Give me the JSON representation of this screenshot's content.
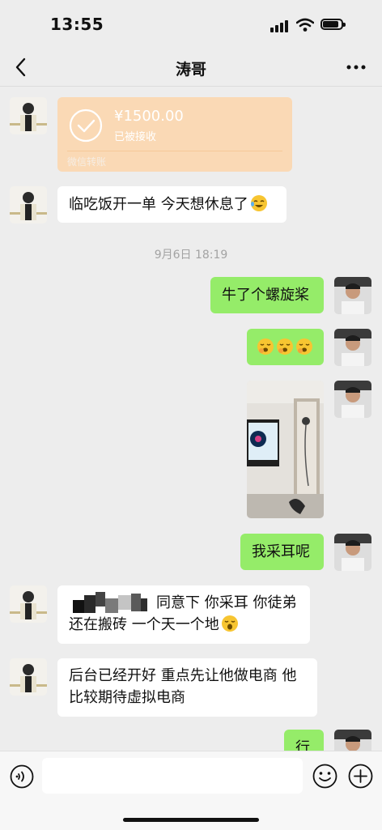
{
  "status_bar": {
    "time": "13:55"
  },
  "header": {
    "title": "涛哥"
  },
  "messages": {
    "transfer": {
      "amount": "¥1500.00",
      "status": "已被接收",
      "footer": "微信转账"
    },
    "m1": "临吃饭开一单 今天想休息了",
    "timestamp": "9月6日 18:19",
    "m2": "牛了个螺旋桨",
    "m4": "我采耳呢",
    "m5_line1": "同意下 你采耳 你徒弟",
    "m5_line2": "还在搬砖 一个天一个地",
    "m6_line1": "后台已经开好 重点先让他做电商 他",
    "m6_line2": "比较期待虚拟电商",
    "m7": "行"
  },
  "colors": {
    "accent_green": "#95ec69",
    "transfer_orange": "#fad9b5",
    "background": "#ededed"
  },
  "icons": [
    "back-arrow-icon",
    "more-icon",
    "voice-icon",
    "emoji-icon",
    "plus-icon",
    "check-icon"
  ]
}
